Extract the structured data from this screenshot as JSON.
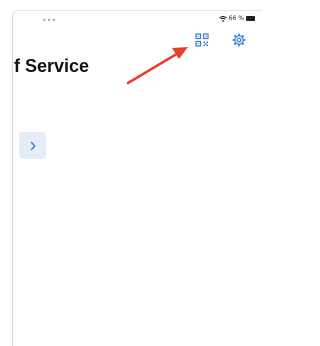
{
  "status_bar": {
    "dots": "•••",
    "battery_text": "66 %",
    "icons": [
      "wifi-icon",
      "battery-icon"
    ]
  },
  "header": {
    "title": "f Service",
    "actions": [
      {
        "name": "qr-code-button",
        "icon": "qr-code-icon"
      },
      {
        "name": "settings-button",
        "icon": "gear-icon"
      }
    ]
  },
  "annotation": {
    "icon": "red-arrow",
    "color": "#e8402a"
  },
  "sidebar_toggle": {
    "icon": "chevron-right-icon"
  },
  "colors": {
    "accent": "#3a7bd5",
    "tab_background": "#e4edf7",
    "title_text": "#111111"
  }
}
